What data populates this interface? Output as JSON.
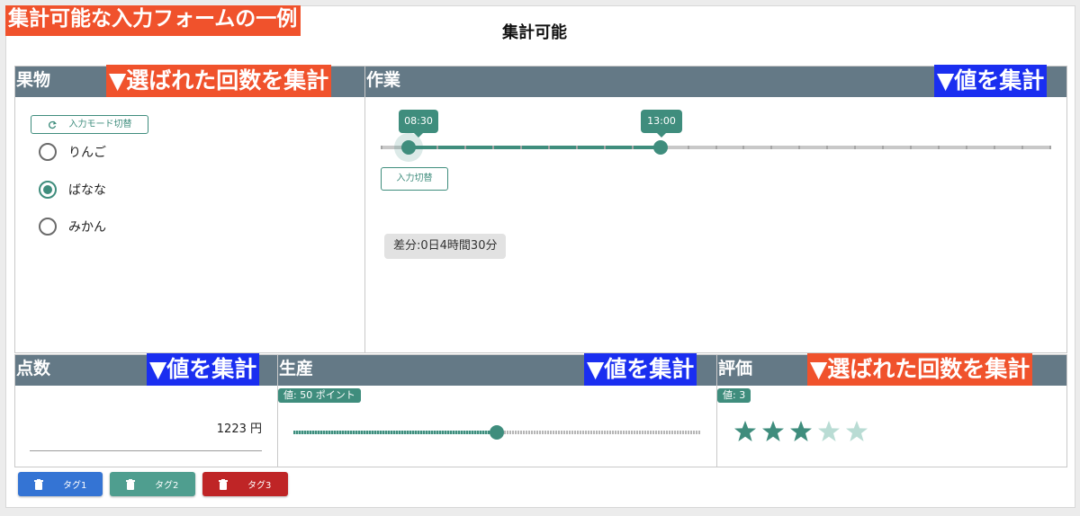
{
  "main_label": "集計可能な入力フォームの一例",
  "page_title": "集計可能",
  "panels": {
    "fruit": {
      "title": "果物",
      "annotation": "▼選ばれた回数を集計",
      "mode_button": "入力モード切替",
      "options": [
        {
          "label": "りんご",
          "selected": false
        },
        {
          "label": "ばなな",
          "selected": true
        },
        {
          "label": "みかん",
          "selected": false
        }
      ]
    },
    "work": {
      "title": "作業",
      "annotation": "▼値を集計",
      "start_time": "08:30",
      "end_time": "13:00",
      "switch_button": "入力切替",
      "difference": "差分:0日4時間30分"
    },
    "score": {
      "title": "点数",
      "annotation": "▼値を集計",
      "value": "1223 円"
    },
    "production": {
      "title": "生産",
      "annotation": "▼値を集計",
      "badge": "値: 50 ポイント",
      "slider_value": 0.5
    },
    "rating": {
      "title": "評価",
      "annotation": "▼選ばれた回数を集計",
      "badge": "値: 3",
      "stars_filled": 3,
      "stars_total": 5
    }
  },
  "tags": [
    {
      "label": "タグ1",
      "color": "#3474d4"
    },
    {
      "label": "タグ2",
      "color": "#4f9e8f"
    },
    {
      "label": "タグ3",
      "color": "#bf2526"
    }
  ],
  "colors": {
    "accent": "#3f8d7d",
    "header": "#647986",
    "annotation_orange": "#f0522c",
    "annotation_blue": "#1a2ef0"
  }
}
